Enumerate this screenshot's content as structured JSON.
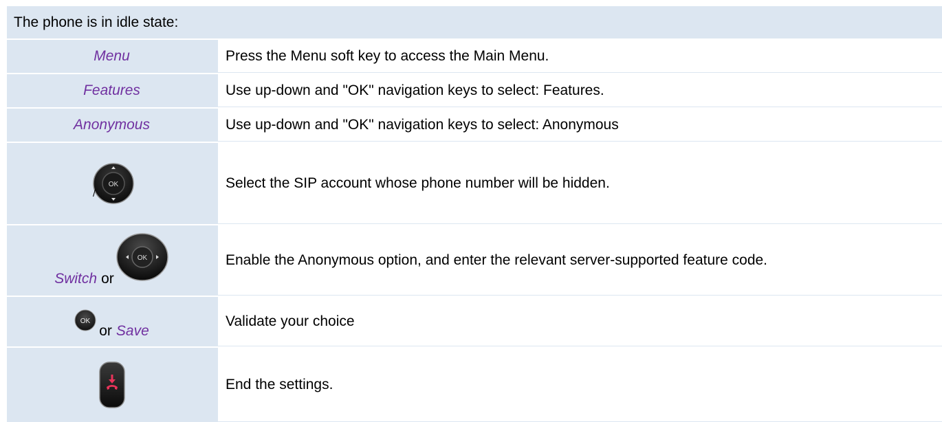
{
  "header": {
    "text": "The phone is in idle state:"
  },
  "rows": [
    {
      "key_label": "Menu",
      "description": "Press the Menu soft key to access the Main Menu."
    },
    {
      "key_label": "Features",
      "description": "Use up-down and \"OK\" navigation keys to select: Features."
    },
    {
      "key_label": "Anonymous",
      "description": "Use up-down and \"OK\" navigation keys to select: Anonymous"
    },
    {
      "icon_text": "OK",
      "slash": "/",
      "description": "Select the SIP account whose phone number will be hidden."
    },
    {
      "key_label": "Switch",
      "joiner": "or",
      "icon_text": "OK",
      "description": "Enable the Anonymous option, and enter the relevant server-supported feature code."
    },
    {
      "icon_text": "OK",
      "joiner": "or",
      "key_label": "Save",
      "description": "Validate your choice"
    },
    {
      "description": "End the settings."
    }
  ],
  "colors": {
    "header_bg": "#dce6f1",
    "key_text": "#7030a0",
    "hangup_red": "#e8345a"
  }
}
